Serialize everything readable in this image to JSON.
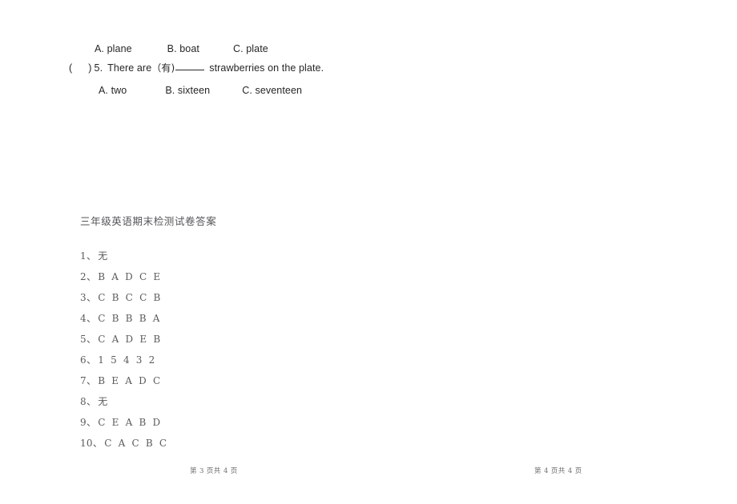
{
  "exam": {
    "options_row_1": {
      "a": "A. plane",
      "b": "B. boat",
      "c": "C. plate"
    },
    "question_5": {
      "bracket_open": "(",
      "bracket_close": ")",
      "number": "5.",
      "text_before": "There are",
      "hint_cn": "（有)",
      "text_after": "strawberries on the plate."
    },
    "options_row_2": {
      "a": "A. two",
      "b": "B. sixteen",
      "c": "C. seventeen"
    }
  },
  "answer_key": {
    "title": "三年级英语期末检测试卷答案",
    "separator": "、",
    "items": [
      {
        "num": "1",
        "value": "无",
        "cjk": true
      },
      {
        "num": "2",
        "value": "B A D C E",
        "cjk": false
      },
      {
        "num": "3",
        "value": "C B C C B",
        "cjk": false
      },
      {
        "num": "4",
        "value": "C B B B A",
        "cjk": false
      },
      {
        "num": "5",
        "value": "C A D E B",
        "cjk": false
      },
      {
        "num": "6",
        "value": "1 5 4 3 2",
        "cjk": false
      },
      {
        "num": "7",
        "value": "B E A D C",
        "cjk": false
      },
      {
        "num": "8",
        "value": "无",
        "cjk": true
      },
      {
        "num": "9",
        "value": "C E A B D",
        "cjk": false
      },
      {
        "num": "10",
        "value": "C A C B C",
        "cjk": false
      }
    ]
  },
  "footers": {
    "left": "第 3 页共 4 页",
    "right": "第 4 页共 4 页"
  }
}
